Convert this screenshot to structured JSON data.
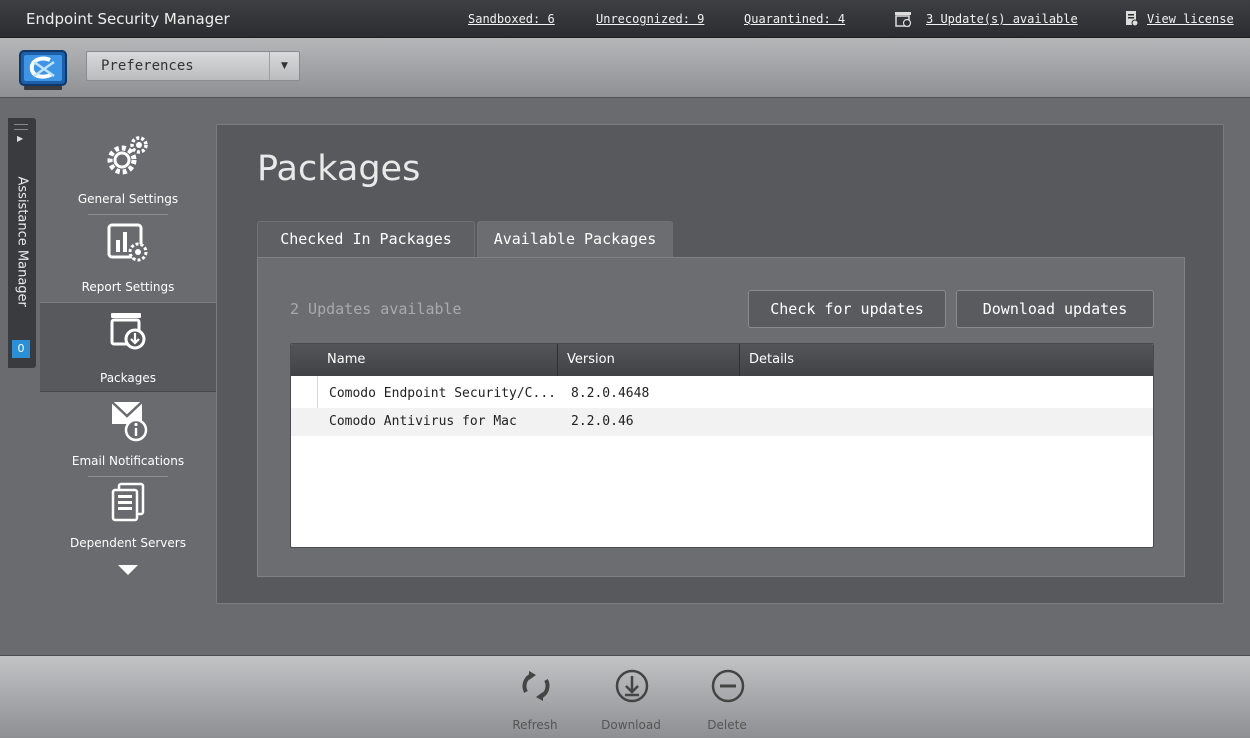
{
  "app": {
    "title": "Endpoint Security Manager"
  },
  "topbar": {
    "sandboxed": "Sandboxed: 6",
    "unrecognized": "Unrecognized: 9",
    "quarantined": "Quarantined: 4",
    "updates": "3 Update(s) available",
    "license": "View license"
  },
  "toolbar": {
    "section": "Preferences"
  },
  "assistance": {
    "label": "Assistance Manager",
    "badge": "0"
  },
  "nav": {
    "items": [
      {
        "label": "General Settings",
        "icon": "gears-icon"
      },
      {
        "label": "Report Settings",
        "icon": "report-icon"
      },
      {
        "label": "Packages",
        "icon": "package-download-icon"
      },
      {
        "label": "Email Notifications",
        "icon": "email-info-icon"
      },
      {
        "label": "Dependent Servers",
        "icon": "servers-icon"
      }
    ]
  },
  "main": {
    "title": "Packages",
    "tabs": [
      {
        "label": "Checked In Packages"
      },
      {
        "label": "Available Packages"
      }
    ],
    "updates_count": "2 Updates available",
    "check_button": "Check for updates",
    "download_button": "Download updates",
    "table": {
      "columns": [
        "Name",
        "Version",
        "Details"
      ],
      "rows": [
        {
          "name": "Comodo Endpoint Security/C...",
          "version": "8.2.0.4648",
          "details": ""
        },
        {
          "name": "Comodo Antivirus for Mac",
          "version": "2.2.0.46",
          "details": ""
        }
      ]
    }
  },
  "bottom": {
    "refresh": "Refresh",
    "download": "Download",
    "delete": "Delete"
  },
  "colors": {
    "badge": "#2a8fd6",
    "panel": "#58595c",
    "header": "#2c2d30"
  }
}
